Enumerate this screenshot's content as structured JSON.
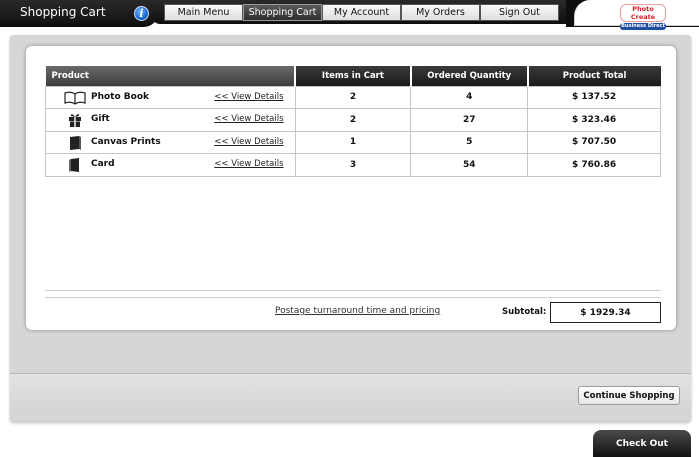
{
  "header": {
    "title": "Shopping Cart",
    "info_glyph": "i",
    "nav": [
      {
        "label": "Main Menu",
        "active": false
      },
      {
        "label": "Shopping Cart",
        "active": true
      },
      {
        "label": "My Account",
        "active": false
      },
      {
        "label": "My Orders",
        "active": false
      },
      {
        "label": "Sign Out",
        "active": false
      }
    ],
    "logo": {
      "line1": "Photo Create",
      "line2": "Business Direct"
    }
  },
  "table": {
    "headers": [
      "Product",
      "Items in Cart",
      "Ordered Quantity",
      "Product Total"
    ],
    "rows": [
      {
        "icon": "book-icon",
        "name": "Photo Book",
        "link": "<< View Details",
        "items": "2",
        "quantity": "4",
        "total": "$ 137.52"
      },
      {
        "icon": "gift-icon",
        "name": "Gift",
        "link": "<< View Details",
        "items": "2",
        "quantity": "27",
        "total": "$ 323.46"
      },
      {
        "icon": "canvas-icon",
        "name": "Canvas Prints",
        "link": "<< View Details",
        "items": "1",
        "quantity": "5",
        "total": "$ 707.50"
      },
      {
        "icon": "card-icon",
        "name": "Card",
        "link": "<< View Details",
        "items": "3",
        "quantity": "54",
        "total": "$ 760.86"
      }
    ]
  },
  "footer": {
    "postage_link": "Postage turnaround time and pricing",
    "subtotal_label": "Subtotal:",
    "subtotal_value": "$ 1929.34",
    "continue_label": "Continue Shopping",
    "checkout_label": "Check Out"
  }
}
